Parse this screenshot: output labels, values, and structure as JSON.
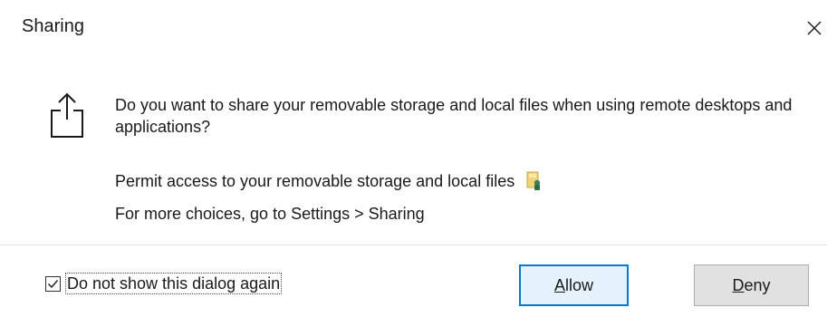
{
  "window": {
    "title": "Sharing",
    "close_icon": "close-icon"
  },
  "content": {
    "icon": "share-icon",
    "question": "Do you want to share your removable storage and local files when using remote desktops and applications?",
    "permit_text": "Permit access to your removable storage and local files",
    "permit_icon": "removable-drive-icon",
    "more_choices": "For more choices, go to Settings > Sharing"
  },
  "footer": {
    "checkbox_label": "Do not show this dialog again",
    "checkbox_checked": true,
    "allow_label_accel": "A",
    "allow_label_rest": "llow",
    "deny_label_accel": "D",
    "deny_label_rest": "eny"
  },
  "colors": {
    "accent": "#0078d7",
    "default_button_bg": "#e5f1fb",
    "button_bg": "#e1e1e1"
  }
}
